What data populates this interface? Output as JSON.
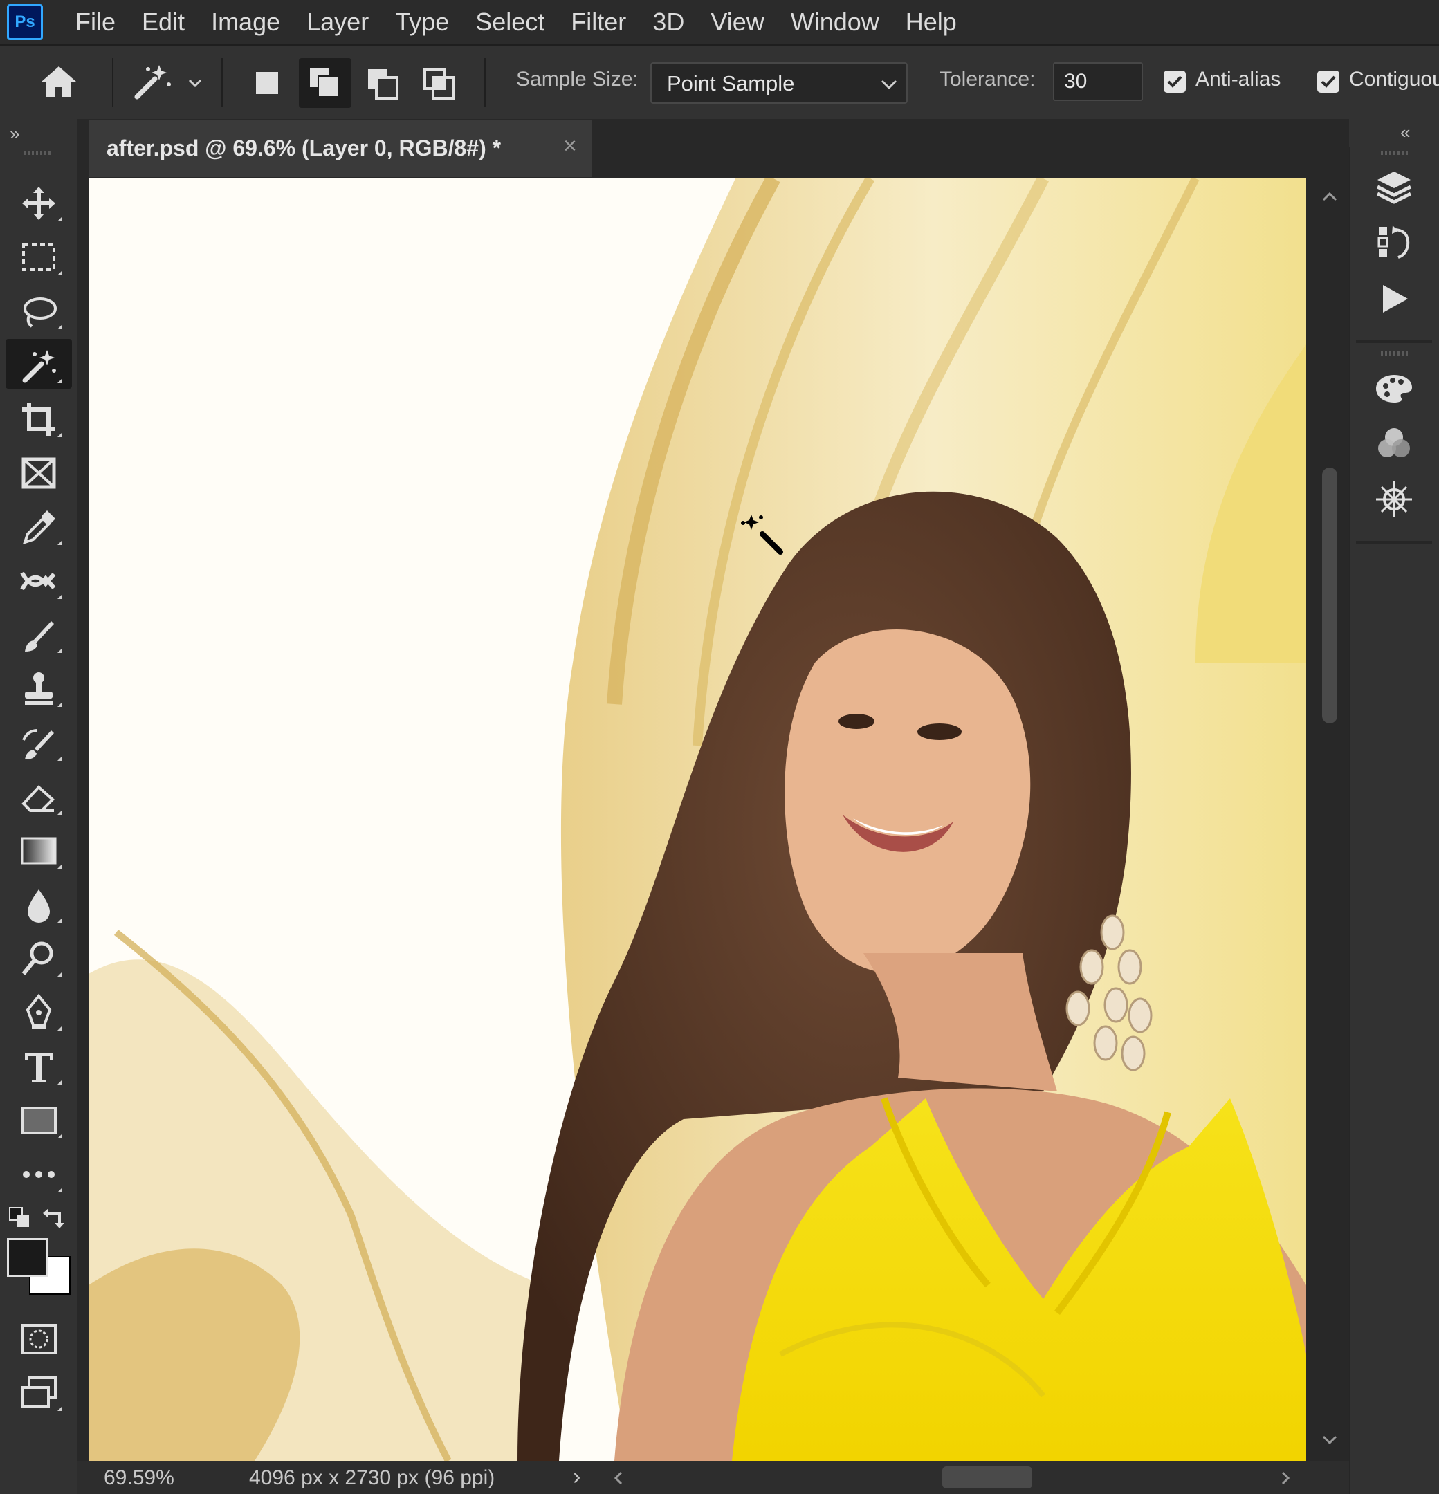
{
  "menu": {
    "logo": "Ps",
    "items": [
      "File",
      "Edit",
      "Image",
      "Layer",
      "Type",
      "Select",
      "Filter",
      "3D",
      "View",
      "Window",
      "Help"
    ]
  },
  "options": {
    "sample_size_label": "Sample Size:",
    "sample_size_value": "Point Sample",
    "tolerance_label": "Tolerance:",
    "tolerance_value": "30",
    "anti_alias_label": "Anti-alias",
    "contiguous_label": "Contiguou"
  },
  "document": {
    "tab_title": "after.psd @ 69.6% (Layer 0, RGB/8#) *",
    "close_glyph": "×"
  },
  "status": {
    "zoom": "69.59%",
    "dimensions": "4096 px x 2730 px (96 ppi)",
    "arrow": "›"
  },
  "colors": {
    "accent": "#31a8ff",
    "foreground_swatch": "#1a1a1a",
    "background_swatch": "#ffffff"
  }
}
